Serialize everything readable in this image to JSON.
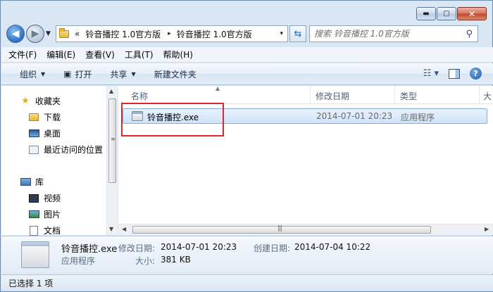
{
  "window": {
    "min_glyph": "▬",
    "max_glyph": "▢",
    "close_glyph": "✕"
  },
  "address": {
    "overflow": "«",
    "crumbs": [
      "铃音播控 1.0官方版",
      "铃音播控 1.0官方版"
    ],
    "separator": "▸",
    "dropdown": "▾"
  },
  "search": {
    "placeholder": "搜索 铃音播控 1.0官方版"
  },
  "menu": [
    "文件(F)",
    "编辑(E)",
    "查看(V)",
    "工具(T)",
    "帮助(H)"
  ],
  "toolbar": {
    "organize": "组织",
    "open": "打开",
    "share": "共享",
    "new_folder": "新建文件夹",
    "dropdown_arrow": "▼",
    "view_glyph": "☷ ▾",
    "help_glyph": "?"
  },
  "sidebar": {
    "favorites": "收藏夹",
    "downloads": "下载",
    "desktop": "桌面",
    "recent": "最近访问的位置",
    "libraries": "库",
    "videos": "视频",
    "pictures": "图片",
    "documents": "文档"
  },
  "columns": {
    "name": "名称",
    "date": "修改日期",
    "type": "类型",
    "extra": "大"
  },
  "files": [
    {
      "name": "铃音播控.exe",
      "modified": "2014-07-01 20:23",
      "type": "应用程序"
    }
  ],
  "details": {
    "name": "铃音播控.exe",
    "kind": "应用程序",
    "modified_label": "修改日期:",
    "modified": "2014-07-01 20:23",
    "created_label": "创建日期:",
    "created": "2014-07-04 10:22",
    "size_label": "大小:",
    "size": "381 KB"
  },
  "status": {
    "selected": "已选择 1 项"
  },
  "colors": {
    "selection_border": "#84acdd",
    "highlight_box": "#e0262a",
    "chrome": "#d9e6f4"
  }
}
